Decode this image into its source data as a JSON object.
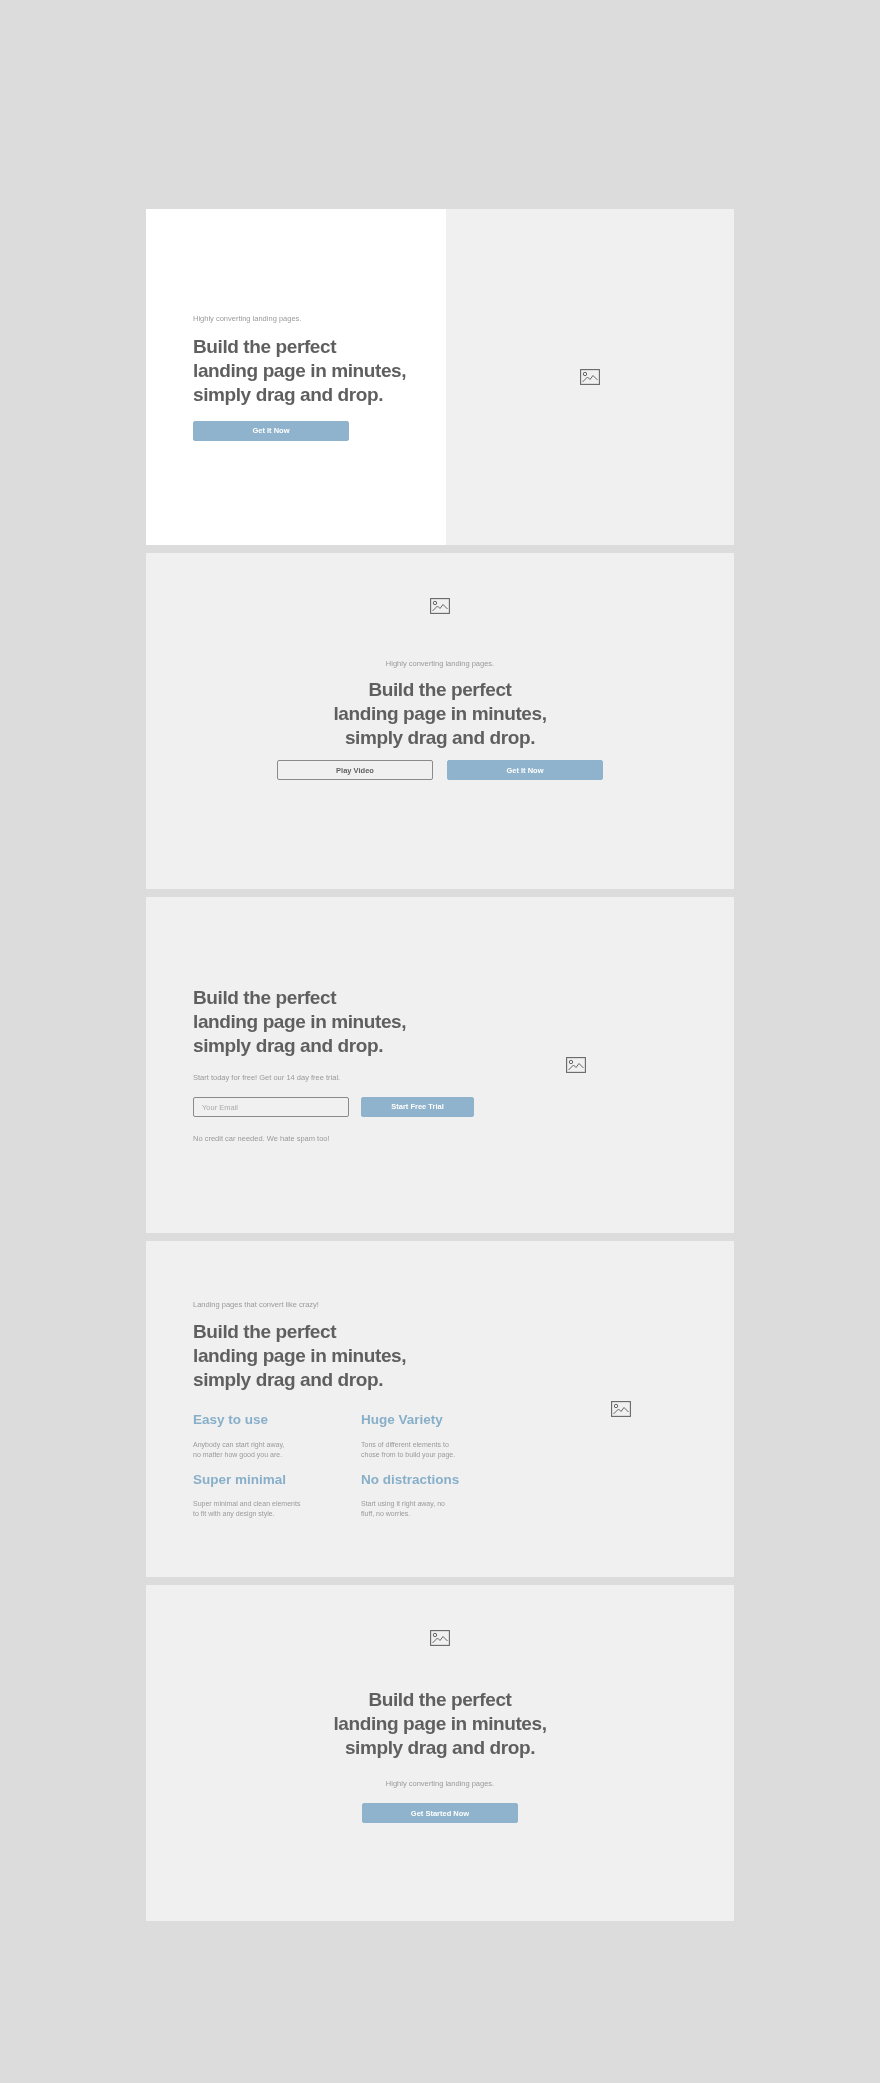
{
  "sections": [
    {
      "kind": "split_hero",
      "subtitle": "Highly converting landing pages.",
      "headline": "Build the perfect\nlanding page in minutes,\nsimply drag and drop.",
      "buttons": [
        {
          "label": "Get It Now",
          "kind": "primary"
        }
      ]
    },
    {
      "kind": "centered_video",
      "subtitle": "Highly converting landing pages.",
      "headline": "Build the perfect\nlanding page in minutes,\nsimply drag and drop.",
      "buttons": [
        {
          "label": "Play Video",
          "kind": "outline"
        },
        {
          "label": "Get It Now",
          "kind": "primary"
        }
      ]
    },
    {
      "kind": "signup",
      "headline": "Build the perfect\nlanding page in minutes,\nsimply drag and drop.",
      "subtitle": "Start today for free! Get our 14 day free trial.",
      "email": {
        "placeholder": "Your Email"
      },
      "buttons": [
        {
          "label": "Start Free Trial",
          "kind": "primary"
        }
      ],
      "note": "No credit car needed. We hate spam too!"
    },
    {
      "kind": "features",
      "subtitle": "Landing pages that convert like crazy!",
      "headline": "Build the perfect\nlanding page in minutes,\nsimply drag and drop.",
      "features": [
        {
          "title": "Easy to use",
          "text": "Anybody can start right away,\nno matter how good you are."
        },
        {
          "title": "Huge Variety",
          "text": "Tons of different elements to\nchose from to build your page."
        },
        {
          "title": "Super minimal",
          "text": "Super minimal and clean elements\nto fit with any design style."
        },
        {
          "title": "No distractions",
          "text": "Start using it right away, no\nfluff, no worries."
        }
      ]
    },
    {
      "kind": "centered_cta",
      "headline": "Build the perfect\nlanding page in minutes,\nsimply drag and drop.",
      "subtitle": "Highly converting landing pages.",
      "buttons": [
        {
          "label": "Get Started Now",
          "kind": "primary"
        }
      ]
    }
  ]
}
